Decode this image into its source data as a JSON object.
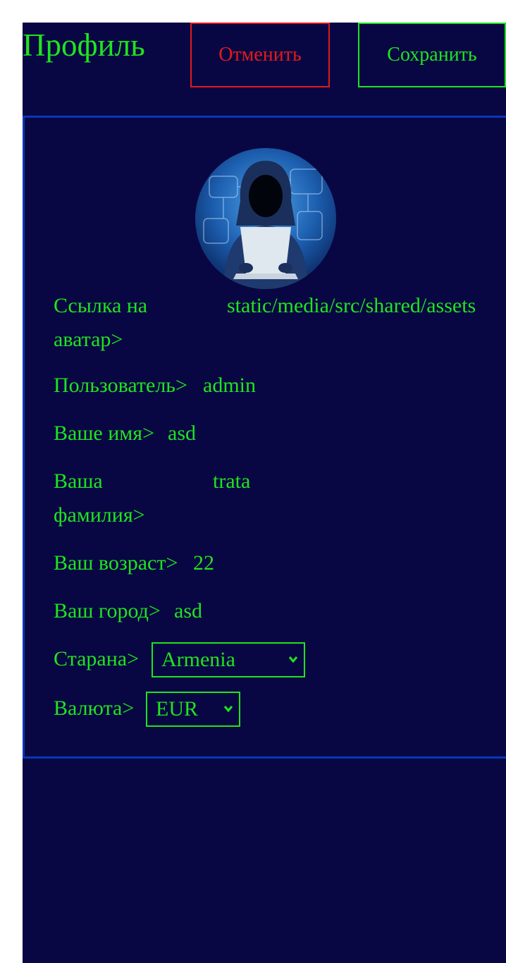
{
  "header": {
    "title": "Профиль",
    "cancel_label": "Отменить",
    "save_label": "Сохранить"
  },
  "profile": {
    "avatar_label": "Ссылка на аватар>",
    "avatar_value": "static/media/src/shared/assets",
    "user_label": "Пользователь>",
    "user_value": "admin",
    "name_label": "Ваше имя>",
    "name_value": "asd",
    "surname_label": "Ваша фамилия>",
    "surname_value": "trata",
    "age_label": "Ваш возраст>",
    "age_value": "22",
    "city_label": "Ваш город>",
    "city_value": "asd",
    "country_label": "Старана>",
    "country_selected": "Armenia",
    "currency_label": "Валюта>",
    "currency_selected": "EUR"
  },
  "colors": {
    "background": "#080743",
    "accent": "#1fe41f",
    "danger": "#e31a1a",
    "card_border": "#0a36b8"
  },
  "icons": {
    "avatar": "hooded-hacker-image",
    "dropdown": "chevron-down-icon"
  }
}
